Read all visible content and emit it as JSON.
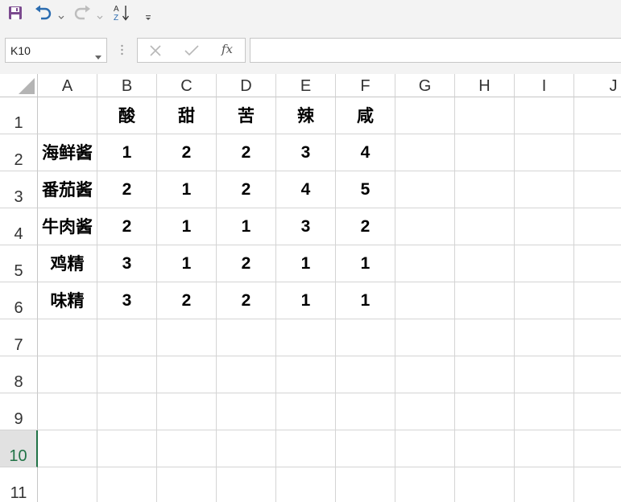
{
  "name_box": {
    "value": "K10"
  },
  "formula_bar": {
    "fx_label": "fx",
    "value": ""
  },
  "toolbar": {
    "icons": [
      "save-icon",
      "undo-icon",
      "redo-icon",
      "sort-ascending-icon",
      "customize-toolbar-icon"
    ]
  },
  "sheet": {
    "columns": [
      "A",
      "B",
      "C",
      "D",
      "E",
      "F",
      "G",
      "H",
      "I",
      "J"
    ],
    "rows": [
      "1",
      "2",
      "3",
      "4",
      "5",
      "6",
      "7",
      "8",
      "9",
      "10",
      "11"
    ],
    "active_row": "10",
    "header_row": [
      "",
      "酸",
      "甜",
      "苦",
      "辣",
      "咸"
    ],
    "data": [
      {
        "label": "海鲜酱",
        "values": [
          "1",
          "2",
          "2",
          "3",
          "4"
        ]
      },
      {
        "label": "番茄酱",
        "values": [
          "2",
          "1",
          "2",
          "4",
          "5"
        ]
      },
      {
        "label": "牛肉酱",
        "values": [
          "2",
          "1",
          "1",
          "3",
          "2"
        ]
      },
      {
        "label": "鸡精",
        "values": [
          "3",
          "1",
          "2",
          "1",
          "1"
        ]
      },
      {
        "label": "味精",
        "values": [
          "3",
          "2",
          "2",
          "1",
          "1"
        ]
      }
    ]
  },
  "colors": {
    "accent": "#217346",
    "toolbar_bg": "#f3f3f3",
    "gridline": "#d4d4d4"
  }
}
